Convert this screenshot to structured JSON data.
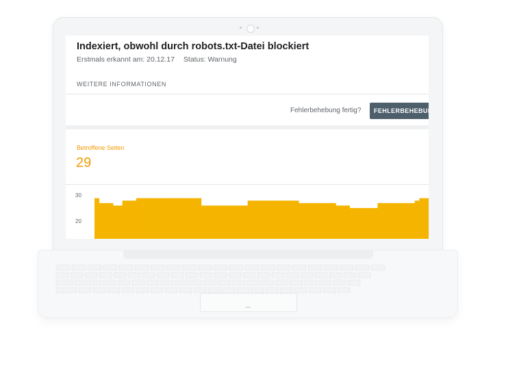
{
  "issue": {
    "title": "Indexiert, obwohl durch robots.txt-Datei blockiert",
    "first_detected": "Erstmals erkannt am: 20.12.17",
    "status": "Status: Warnung",
    "more_info": "WEITERE INFORMATIONEN"
  },
  "fix": {
    "prompt": "Fehlerbehebung fertig?",
    "button_label": "FEHLERBEHEBUNG"
  },
  "stats": {
    "label": "Betroffene Seiten",
    "value": "29"
  },
  "colors": {
    "accent": "#f29900",
    "bar": "#f4b400",
    "button": "#4e5f6c"
  },
  "chart_data": {
    "type": "bar",
    "yticks": [
      "30",
      "20"
    ],
    "ylim": [
      13,
      31
    ],
    "values": [
      29,
      27,
      27,
      27,
      26,
      26,
      28,
      28,
      28,
      29,
      29,
      29,
      29,
      29,
      29,
      29,
      29,
      29,
      29,
      29,
      29,
      29,
      29,
      26,
      26,
      26,
      26,
      26,
      26,
      26,
      26,
      26,
      26,
      28,
      28,
      28,
      28,
      28,
      28,
      28,
      28,
      28,
      28,
      28,
      27,
      27,
      27,
      27,
      27,
      27,
      27,
      27,
      26,
      26,
      26,
      25,
      25,
      25,
      25,
      25,
      25,
      27,
      27,
      27,
      27,
      27,
      27,
      27,
      27,
      28,
      29,
      29
    ]
  }
}
